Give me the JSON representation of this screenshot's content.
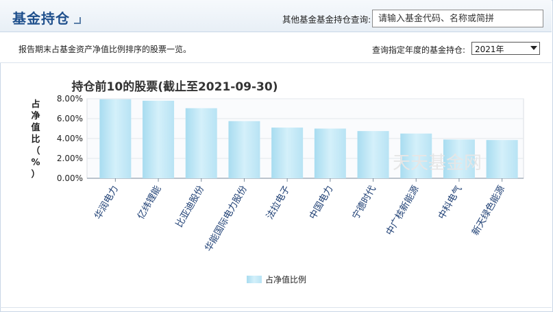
{
  "header": {
    "title": "基金持仓"
  },
  "search": {
    "label": "其他基金基金持仓查询:",
    "placeholder": "请输入基金代码、名称或简拼"
  },
  "subbar": {
    "description": "报告期末占基金资产净值比例排序的股票一览。",
    "year_label": "查询指定年度的基金持仓:",
    "year_value": "2021年"
  },
  "watermark": "天天基金网",
  "chart_data": {
    "type": "bar",
    "title": "持仓前10的股票(截止至2021-09-30)",
    "ylabel": "占净值比（%）",
    "ylabel_chars": [
      "占",
      "净",
      "值",
      "比",
      "（",
      "%",
      "）"
    ],
    "ylim": [
      0,
      8
    ],
    "yticks": [
      "0.00%",
      "2.00%",
      "4.00%",
      "6.00%",
      "8.00%"
    ],
    "ytick_values": [
      0,
      2,
      4,
      6,
      8
    ],
    "categories": [
      "华润电力",
      "亿纬锂能",
      "比亚迪股份",
      "华能国际电力股份",
      "法拉电子",
      "中国电力",
      "宁德时代",
      "中广核新能源",
      "中科电气",
      "新天绿色能源"
    ],
    "series": [
      {
        "name": "占净值比例",
        "values": [
          7.95,
          7.8,
          7.05,
          5.75,
          5.1,
          5.0,
          4.75,
          4.5,
          3.9,
          3.85
        ]
      }
    ],
    "legend_position": "bottom-center",
    "bar_color": "#bfe6f5",
    "grid": true
  }
}
